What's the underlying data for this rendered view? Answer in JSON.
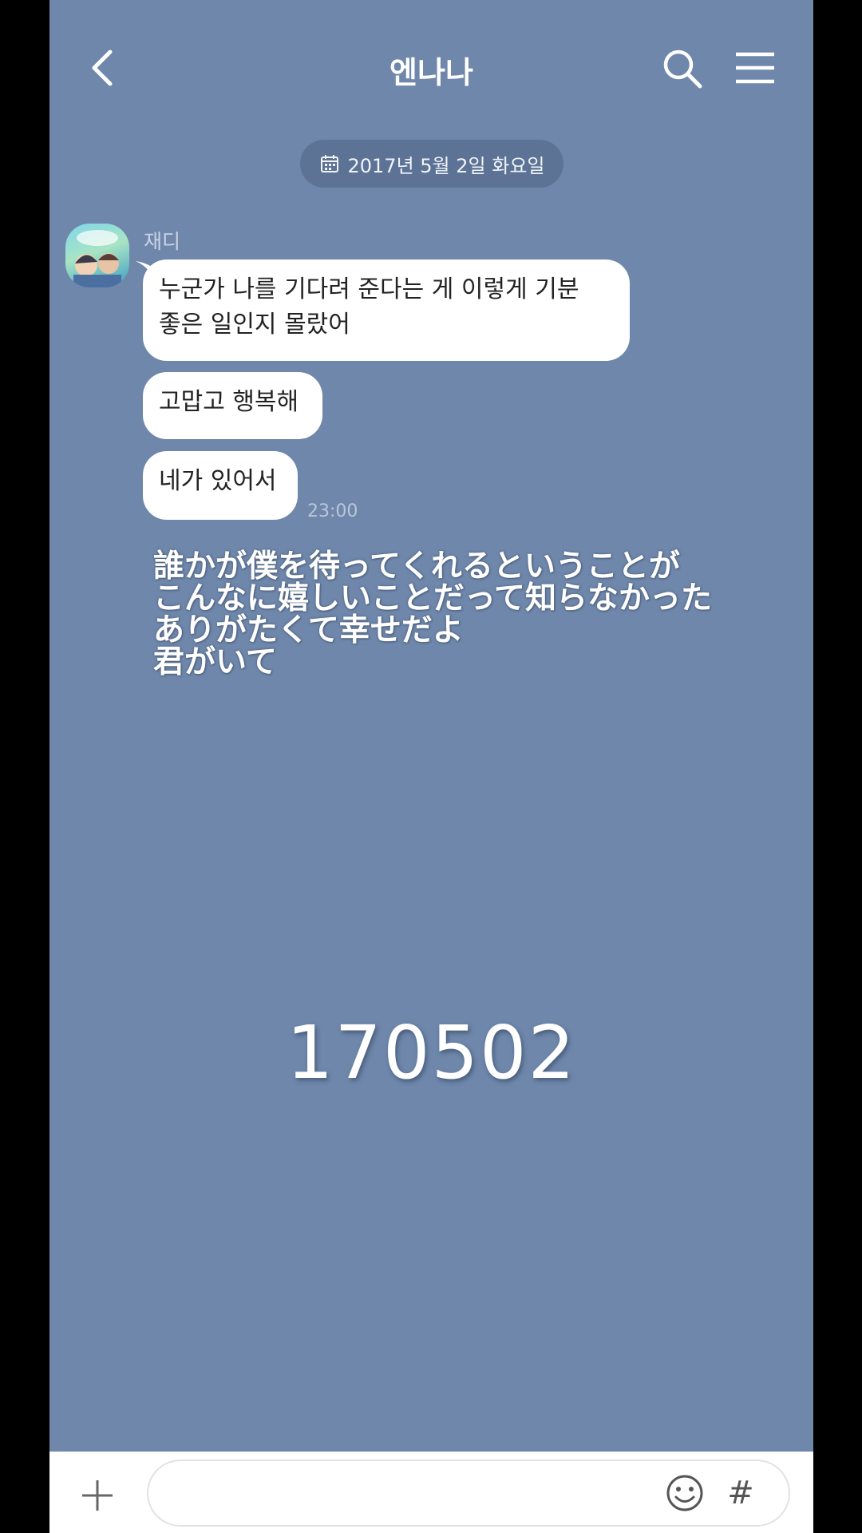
{
  "header": {
    "title": "엔나나"
  },
  "date_divider": {
    "text": "2017년 5월 2일 화요일"
  },
  "message_group": {
    "sender_name": "재디",
    "messages": [
      {
        "lines": [
          "누군가 나를 기다려 준다는 게 이렇게 기분",
          "좋은 일인지 몰랐어"
        ]
      },
      {
        "lines": [
          "고맙고 행복해"
        ]
      },
      {
        "lines": [
          "네가 있어서"
        ]
      }
    ],
    "time": "23:00"
  },
  "overlay_caption": {
    "lines": [
      "誰かが僕を待ってくれるということが",
      "こんなに嬉しいことだって知らなかった",
      "ありがたくて幸せだよ",
      "君がいて"
    ]
  },
  "overlay_date": "170502",
  "input_bar": {
    "placeholder": "",
    "hash_label": "#"
  },
  "colors": {
    "background": "#6e87ab",
    "bubble": "#ffffff",
    "date_pill": "#5c7395"
  },
  "icons": [
    "back-arrow-icon",
    "search-icon",
    "menu-icon",
    "calendar-icon",
    "plus-icon",
    "emoji-icon"
  ]
}
